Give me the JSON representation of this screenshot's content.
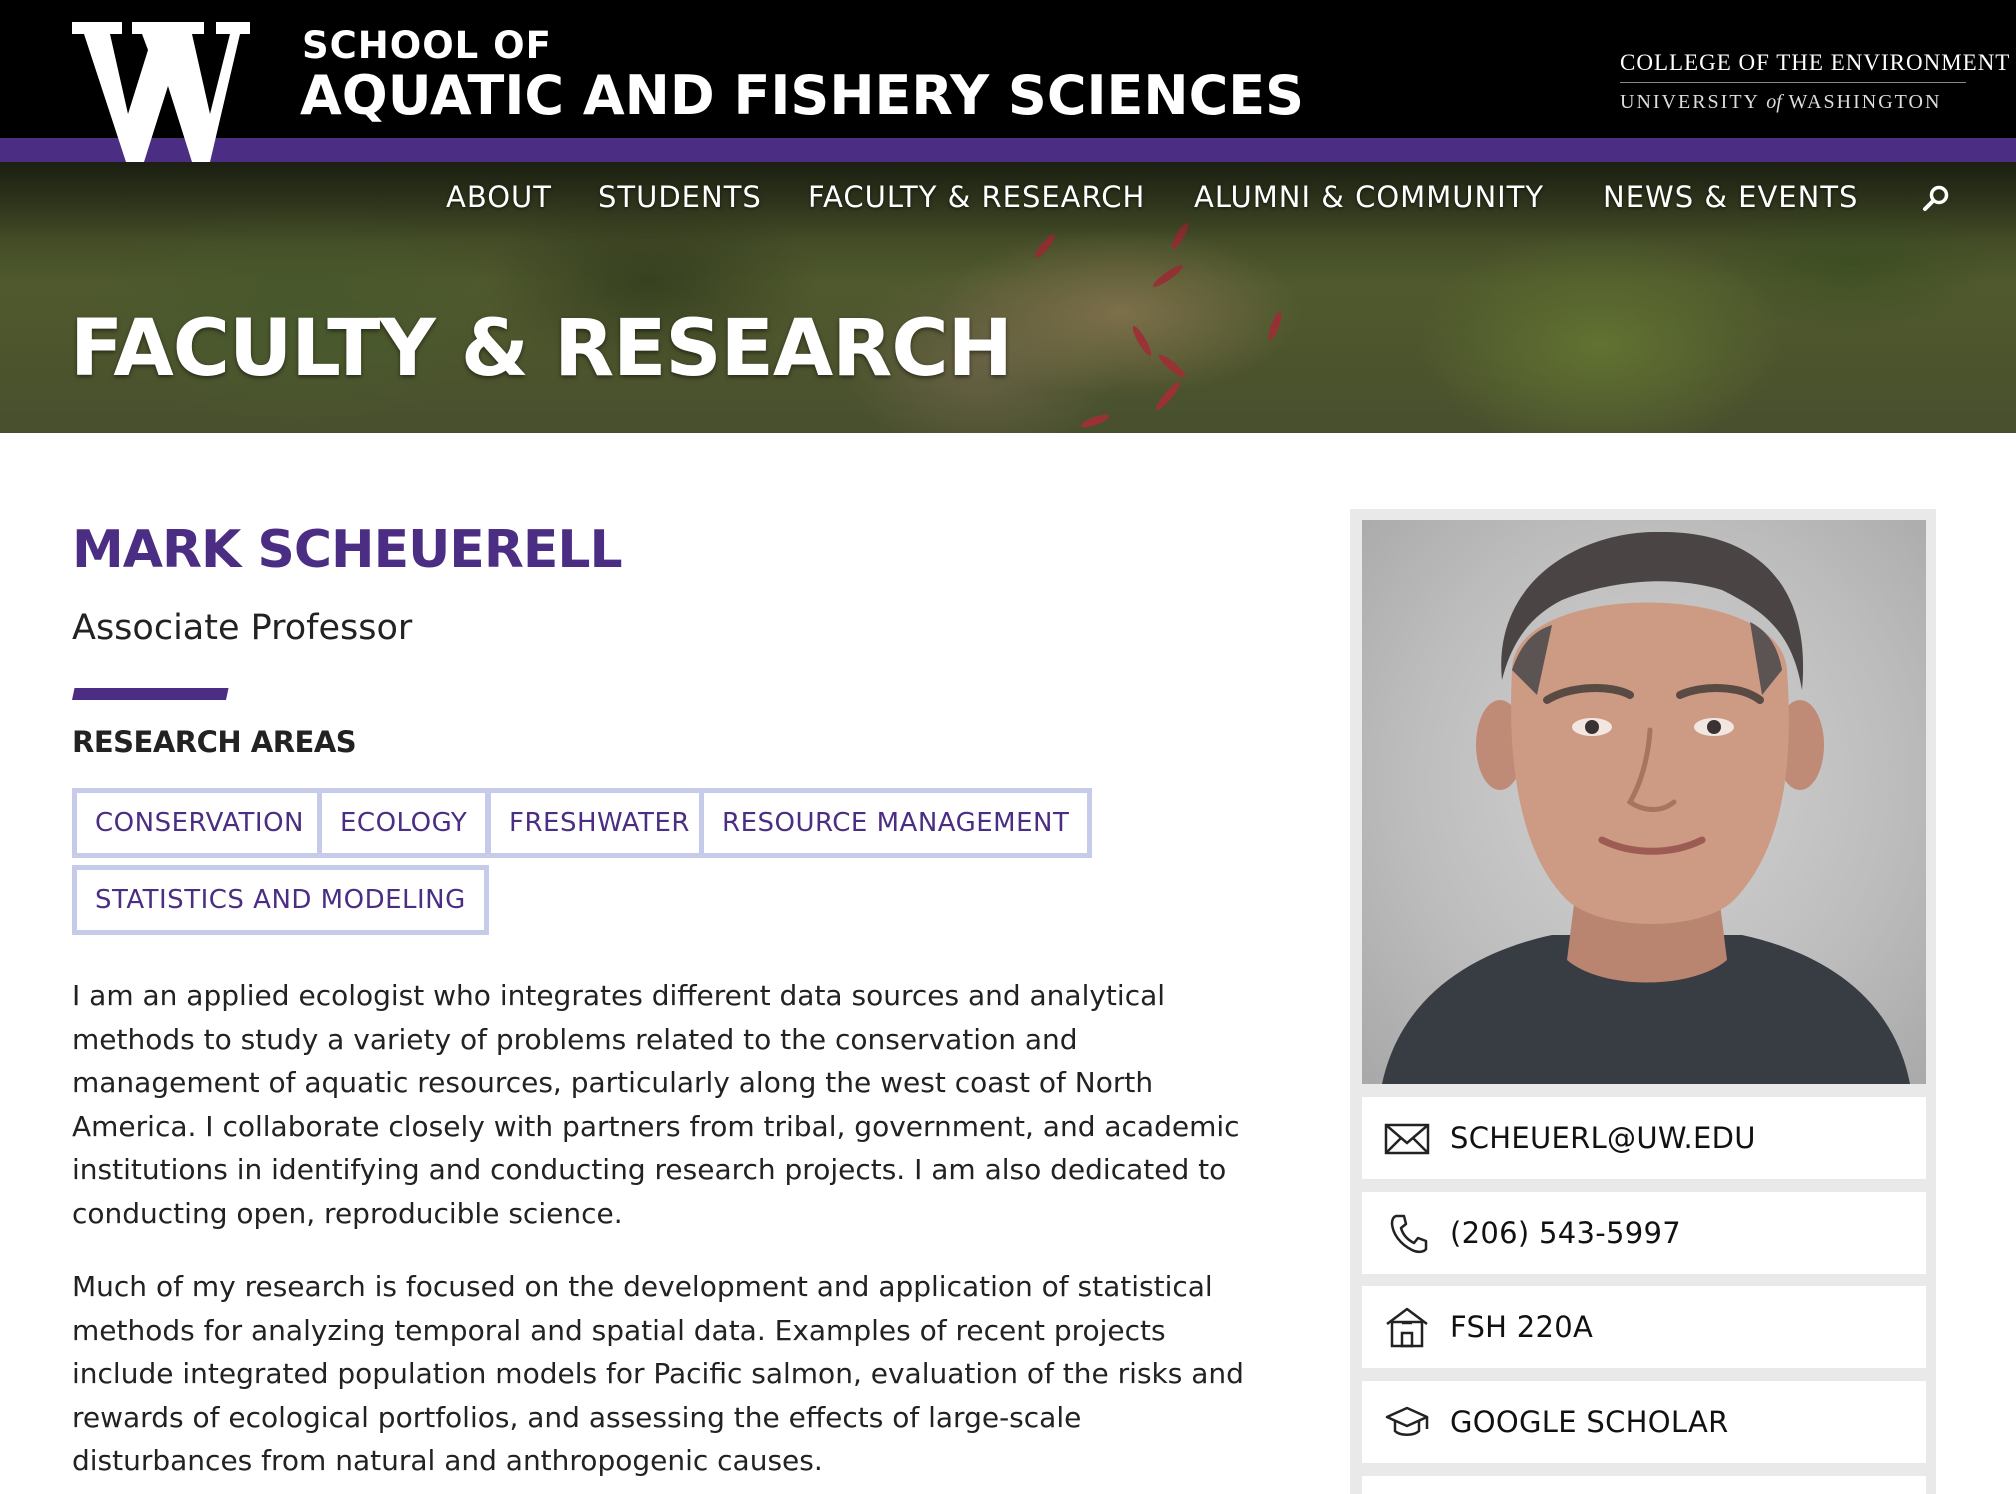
{
  "header": {
    "school_line1": "SCHOOL OF",
    "school_line2": "AQUATIC AND FISHERY SCIENCES",
    "college": "COLLEGE OF THE ENVIRONMENT",
    "university_pre": "UNIVERSITY ",
    "university_of": "of",
    "university_post": " WASHINGTON",
    "logo_letter": "W"
  },
  "nav": {
    "items": [
      "ABOUT",
      "STUDENTS",
      "FACULTY & RESEARCH",
      "ALUMNI & COMMUNITY",
      "NEWS & EVENTS"
    ],
    "search_icon": "search-icon"
  },
  "hero": {
    "title": "FACULTY & RESEARCH"
  },
  "profile": {
    "name": "MARK SCHEUERELL",
    "title": "Associate Professor",
    "research_heading": "RESEARCH AREAS",
    "research_areas": [
      "CONSERVATION",
      "ECOLOGY",
      "FRESHWATER",
      "RESOURCE MANAGEMENT",
      "STATISTICS AND MODELING"
    ],
    "bio": [
      "I am an applied ecologist who integrates different data sources and analytical methods to study a variety of problems related to the conservation and management of aquatic resources, particularly along the west coast of North America. I collaborate closely with partners from tribal, government, and academic institutions in identifying and conducting research projects. I am also dedicated to conducting open, reproducible science.",
      "Much of my research is focused on the development and application of statistical methods for analyzing temporal and spatial data. Examples of recent projects include integrated population models for Pacific salmon, evaluation of the risks and rewards of ecological portfolios, and assessing the effects of large-scale disturbances from natural and anthropogenic causes."
    ]
  },
  "contact": {
    "email": "SCHEUERL@UW.EDU",
    "phone": "(206) 543-5997",
    "office": "FSH 220A",
    "scholar": "GOOGLE SCHOLAR"
  },
  "colors": {
    "uw_purple": "#4b2e83",
    "tag_border": "#c5cbe8",
    "header_bg": "#000000"
  }
}
